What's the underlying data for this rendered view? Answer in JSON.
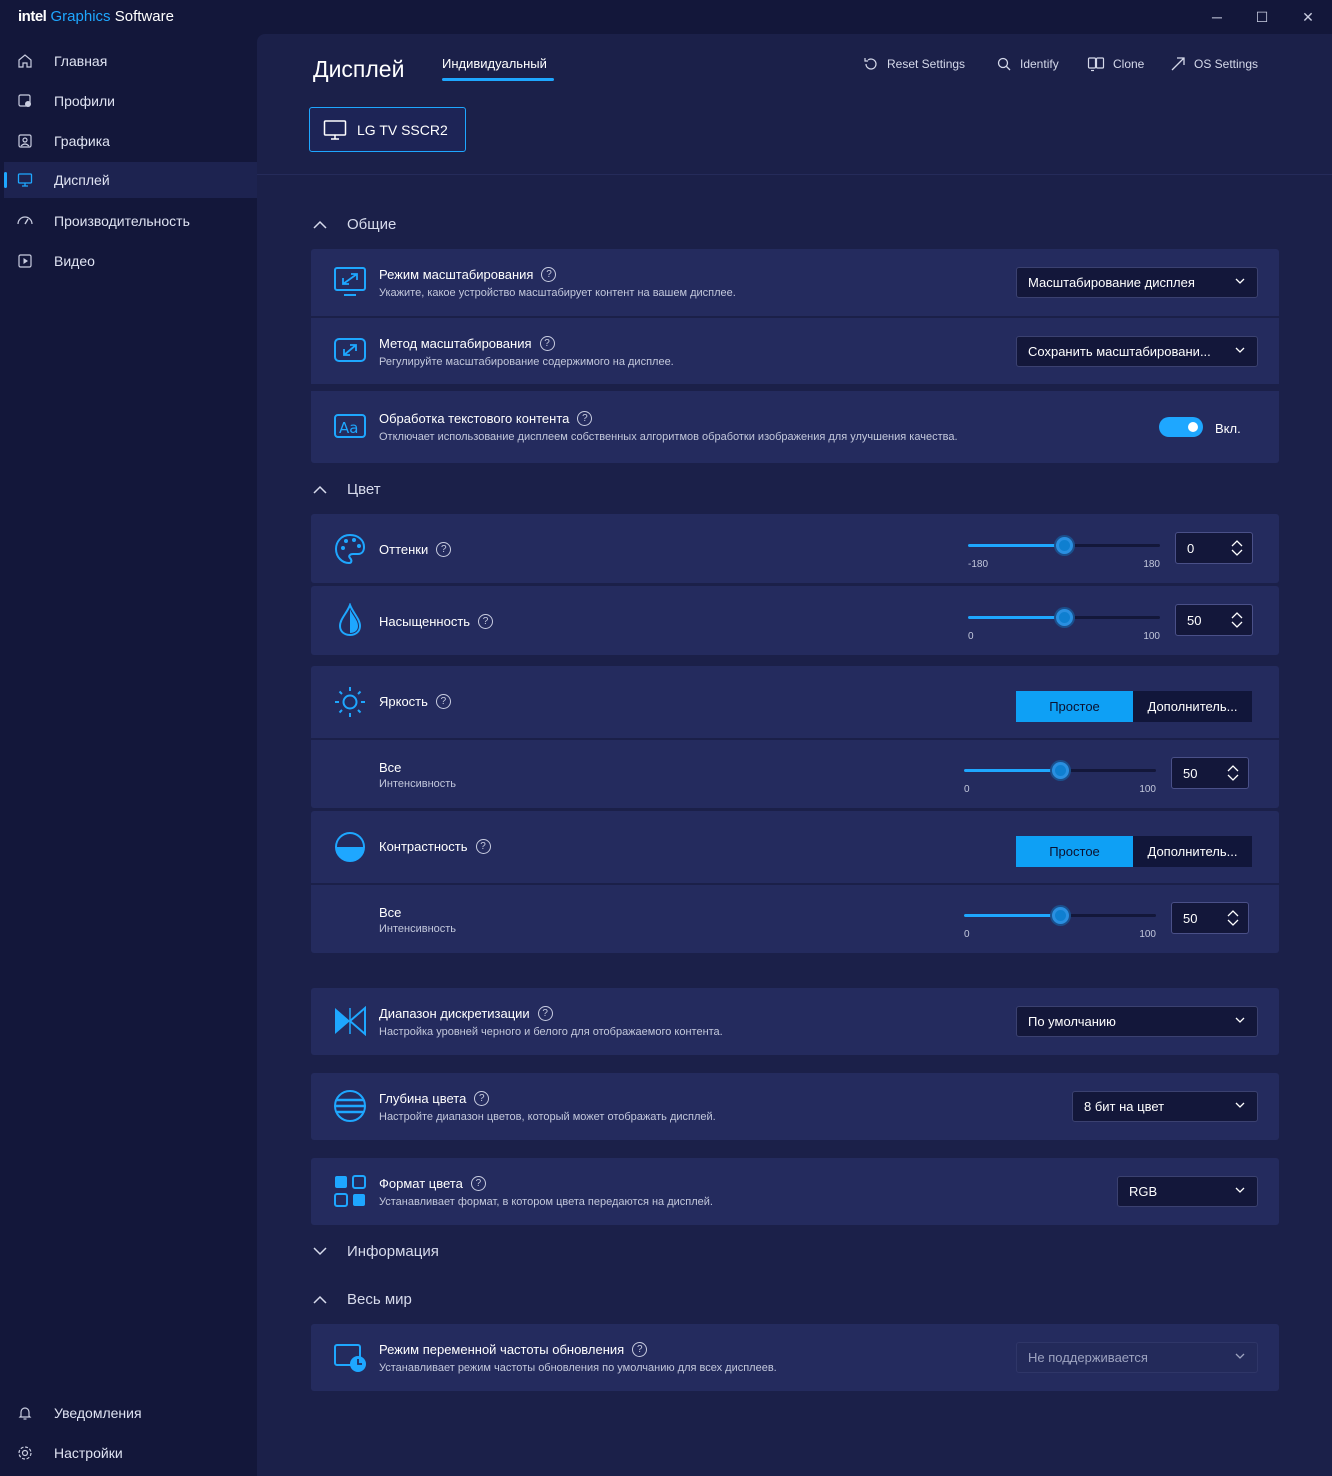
{
  "titlebar": {
    "brand_intel": "intel",
    "brand_graphics": "Graphics",
    "brand_software": "Software",
    "minimize": "─",
    "maximize": "☐",
    "close": "✕"
  },
  "sidebar": {
    "items": [
      {
        "label": "Главная",
        "icon": "home-icon"
      },
      {
        "label": "Профили",
        "icon": "profiles-icon"
      },
      {
        "label": "Графика",
        "icon": "graphics-icon"
      },
      {
        "label": "Дисплей",
        "icon": "display-icon",
        "active": true
      },
      {
        "label": "Производительность",
        "icon": "performance-icon"
      },
      {
        "label": "Видео",
        "icon": "video-icon"
      }
    ],
    "bottom": [
      {
        "label": "Уведомления",
        "icon": "bell-icon"
      },
      {
        "label": "Настройки",
        "icon": "gear-icon"
      }
    ]
  },
  "header": {
    "title": "Дисплей",
    "tab": "Индивидуальный",
    "buttons": [
      "Reset Settings",
      "Identify",
      "Clone",
      "OS Settings"
    ],
    "monitor": "LG TV SSCR2"
  },
  "sections": {
    "general": "Общие",
    "color": "Цвет",
    "info": "Информация",
    "global": "Весь мир"
  },
  "general": {
    "scaling_mode": {
      "title": "Режим масштабирования",
      "desc": "Укажите, какое устройство масштабирует контент на вашем дисплее.",
      "value": "Масштабирование дисплея"
    },
    "scaling_method": {
      "title": "Метод масштабирования",
      "desc": "Регулируйте масштабирование содержимого на дисплее.",
      "value": "Сохранить масштабировани..."
    },
    "text_processing": {
      "title": "Обработка текстового контента",
      "desc": "Отключает использование дисплеем собственных алгоритмов обработки изображения для улучшения качества.",
      "state": "Вкл.",
      "on": true
    }
  },
  "color": {
    "hue": {
      "title": "Оттенки",
      "min": "-180",
      "max": "180",
      "value": "0",
      "fraction": 0.5
    },
    "saturation": {
      "title": "Насыщенность",
      "min": "0",
      "max": "100",
      "value": "50",
      "fraction": 0.5
    },
    "brightness": {
      "title": "Яркость",
      "seg_simple": "Простое",
      "seg_advanced": "Дополнитель...",
      "all": "Все",
      "intensity": "Интенсивность",
      "min": "0",
      "max": "100",
      "value": "50",
      "fraction": 0.5
    },
    "contrast": {
      "title": "Контрастность",
      "seg_simple": "Простое",
      "seg_advanced": "Дополнитель...",
      "all": "Все",
      "intensity": "Интенсивность",
      "min": "0",
      "max": "100",
      "value": "50",
      "fraction": 0.5
    },
    "quant_range": {
      "title": "Диапазон дискретизации",
      "desc": "Настройка уровней черного и белого для отображаемого контента.",
      "value": "По умолчанию"
    },
    "bit_depth": {
      "title": "Глубина цвета",
      "desc": "Настройте диапазон цветов, который может отображать дисплей.",
      "value": "8 бит на цвет"
    },
    "color_format": {
      "title": "Формат цвета",
      "desc": "Устанавливает формат, в котором цвета передаются на дисплей.",
      "value": "RGB"
    }
  },
  "global": {
    "vrr": {
      "title": "Режим переменной частоты обновления",
      "desc": "Устанавливает режим частоты обновления по умолчанию для всех дисплеев.",
      "value": "Не поддерживается"
    }
  },
  "colors": {
    "accent": "#1ea7ff",
    "bg": "#13173a",
    "panel": "#1b2049",
    "card": "#242b5e"
  }
}
